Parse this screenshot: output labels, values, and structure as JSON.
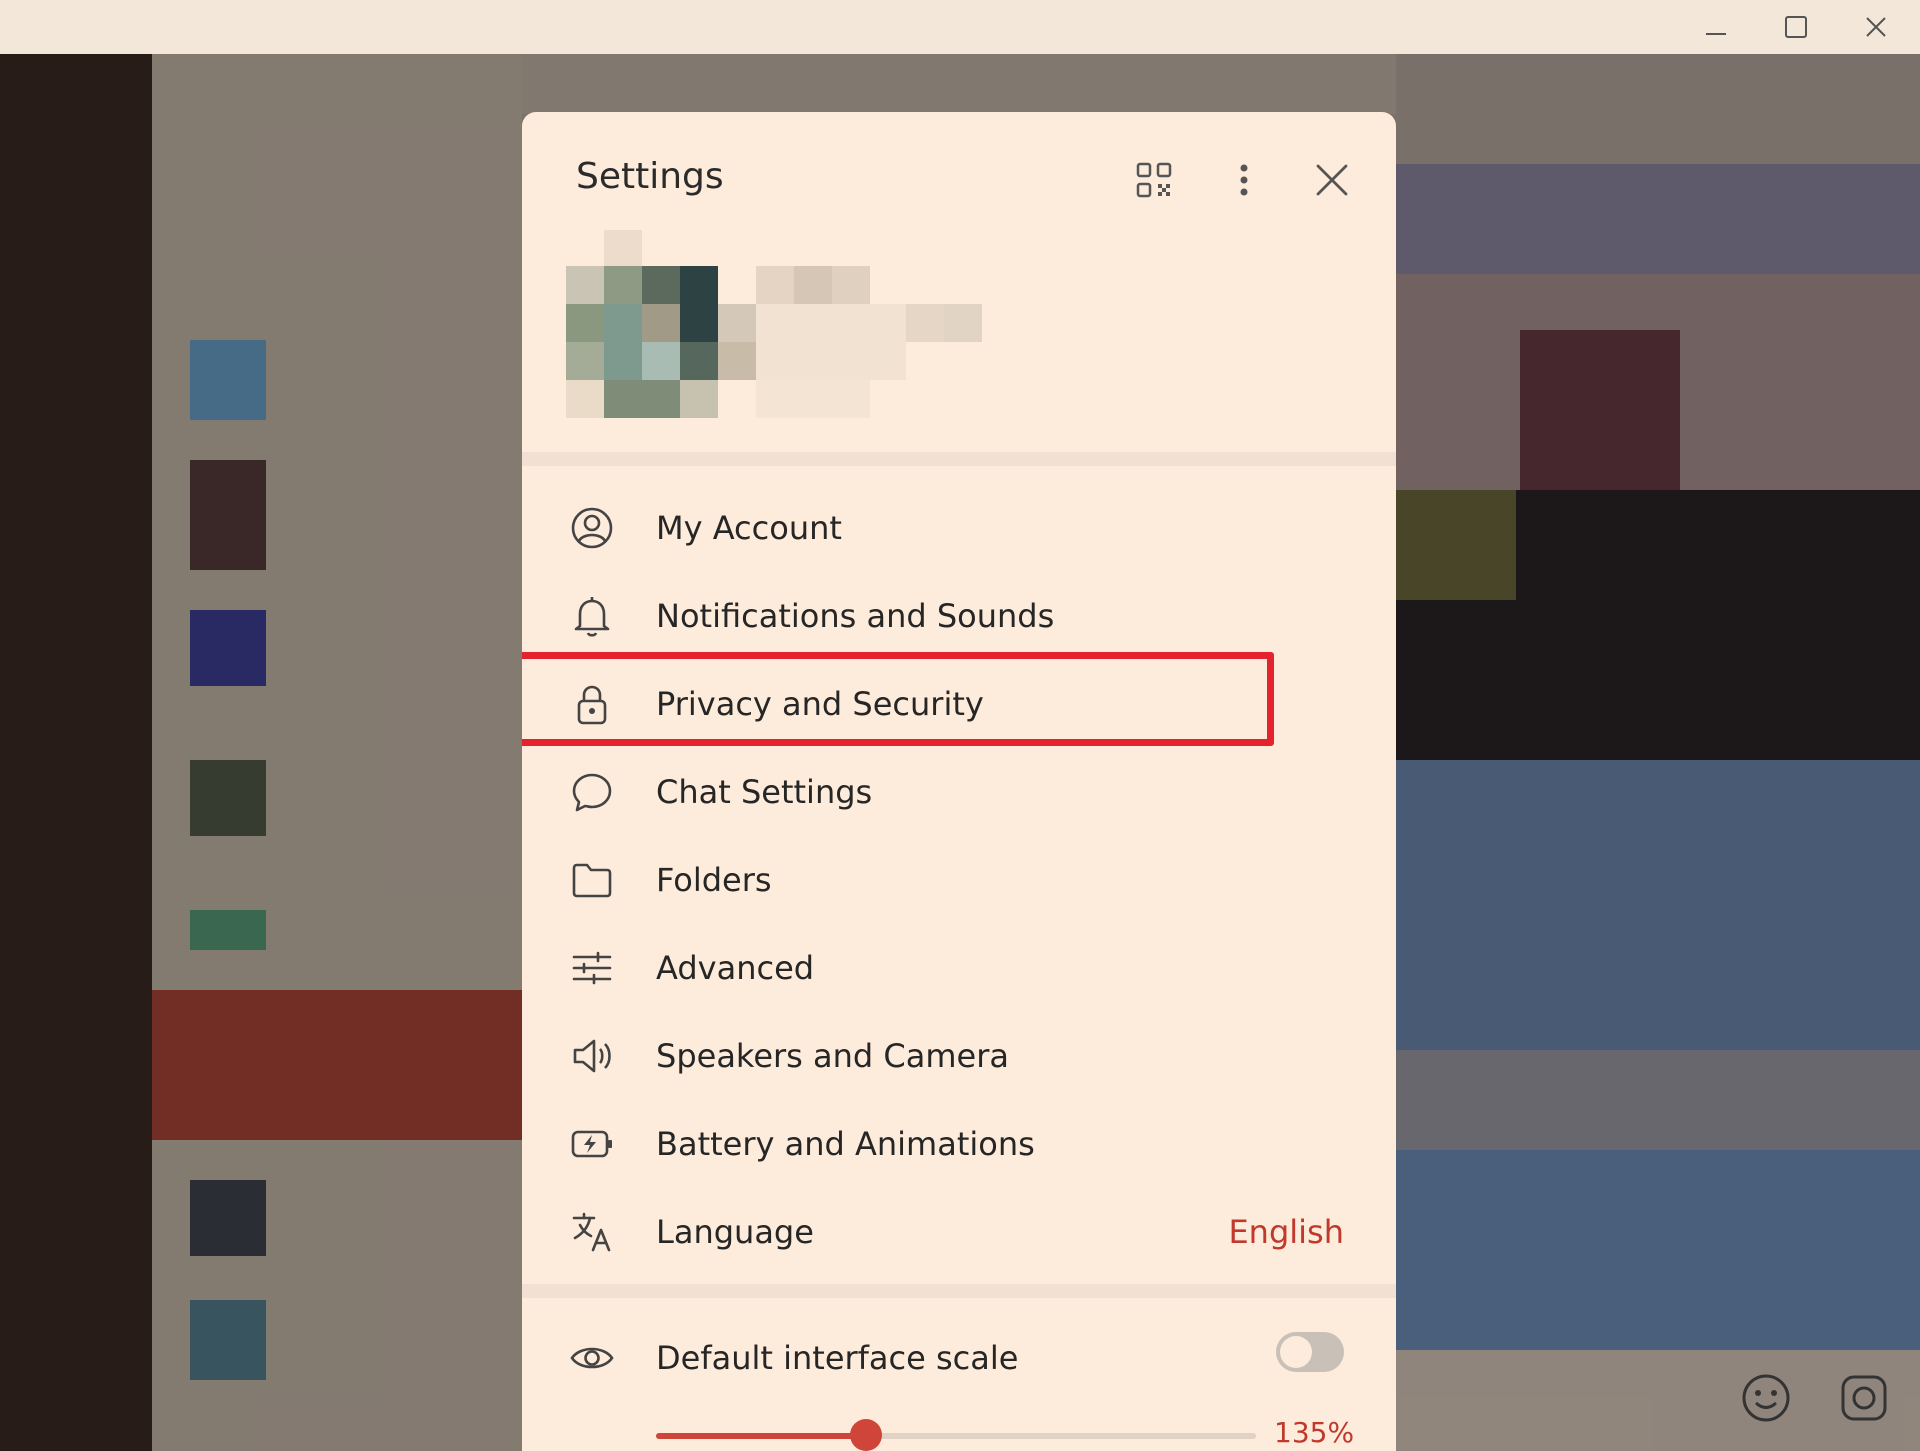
{
  "window": {
    "controls": [
      "minimize",
      "maximize",
      "close"
    ]
  },
  "settings": {
    "title": "Settings",
    "header_icons": [
      "qr-code-icon",
      "more-vertical-icon",
      "close-icon"
    ],
    "menu": [
      {
        "label": "My Account",
        "icon": "account-circle-icon"
      },
      {
        "label": "Notifications and Sounds",
        "icon": "bell-icon"
      },
      {
        "label": "Privacy and Security",
        "icon": "lock-icon",
        "highlighted": true
      },
      {
        "label": "Chat Settings",
        "icon": "chat-bubble-icon"
      },
      {
        "label": "Folders",
        "icon": "folder-icon"
      },
      {
        "label": "Advanced",
        "icon": "sliders-icon"
      },
      {
        "label": "Speakers and Camera",
        "icon": "speaker-icon"
      },
      {
        "label": "Battery and Animations",
        "icon": "battery-icon"
      },
      {
        "label": "Language",
        "icon": "translate-icon",
        "value": "English"
      }
    ],
    "scale": {
      "label": "Default interface scale",
      "icon": "eye-icon",
      "toggle_on": false,
      "slider_fraction": 0.35,
      "value": "135%"
    }
  },
  "colors": {
    "accent": "#c0392b",
    "highlight_box": "#e5232f",
    "dialog_bg": "#fdebdb"
  }
}
